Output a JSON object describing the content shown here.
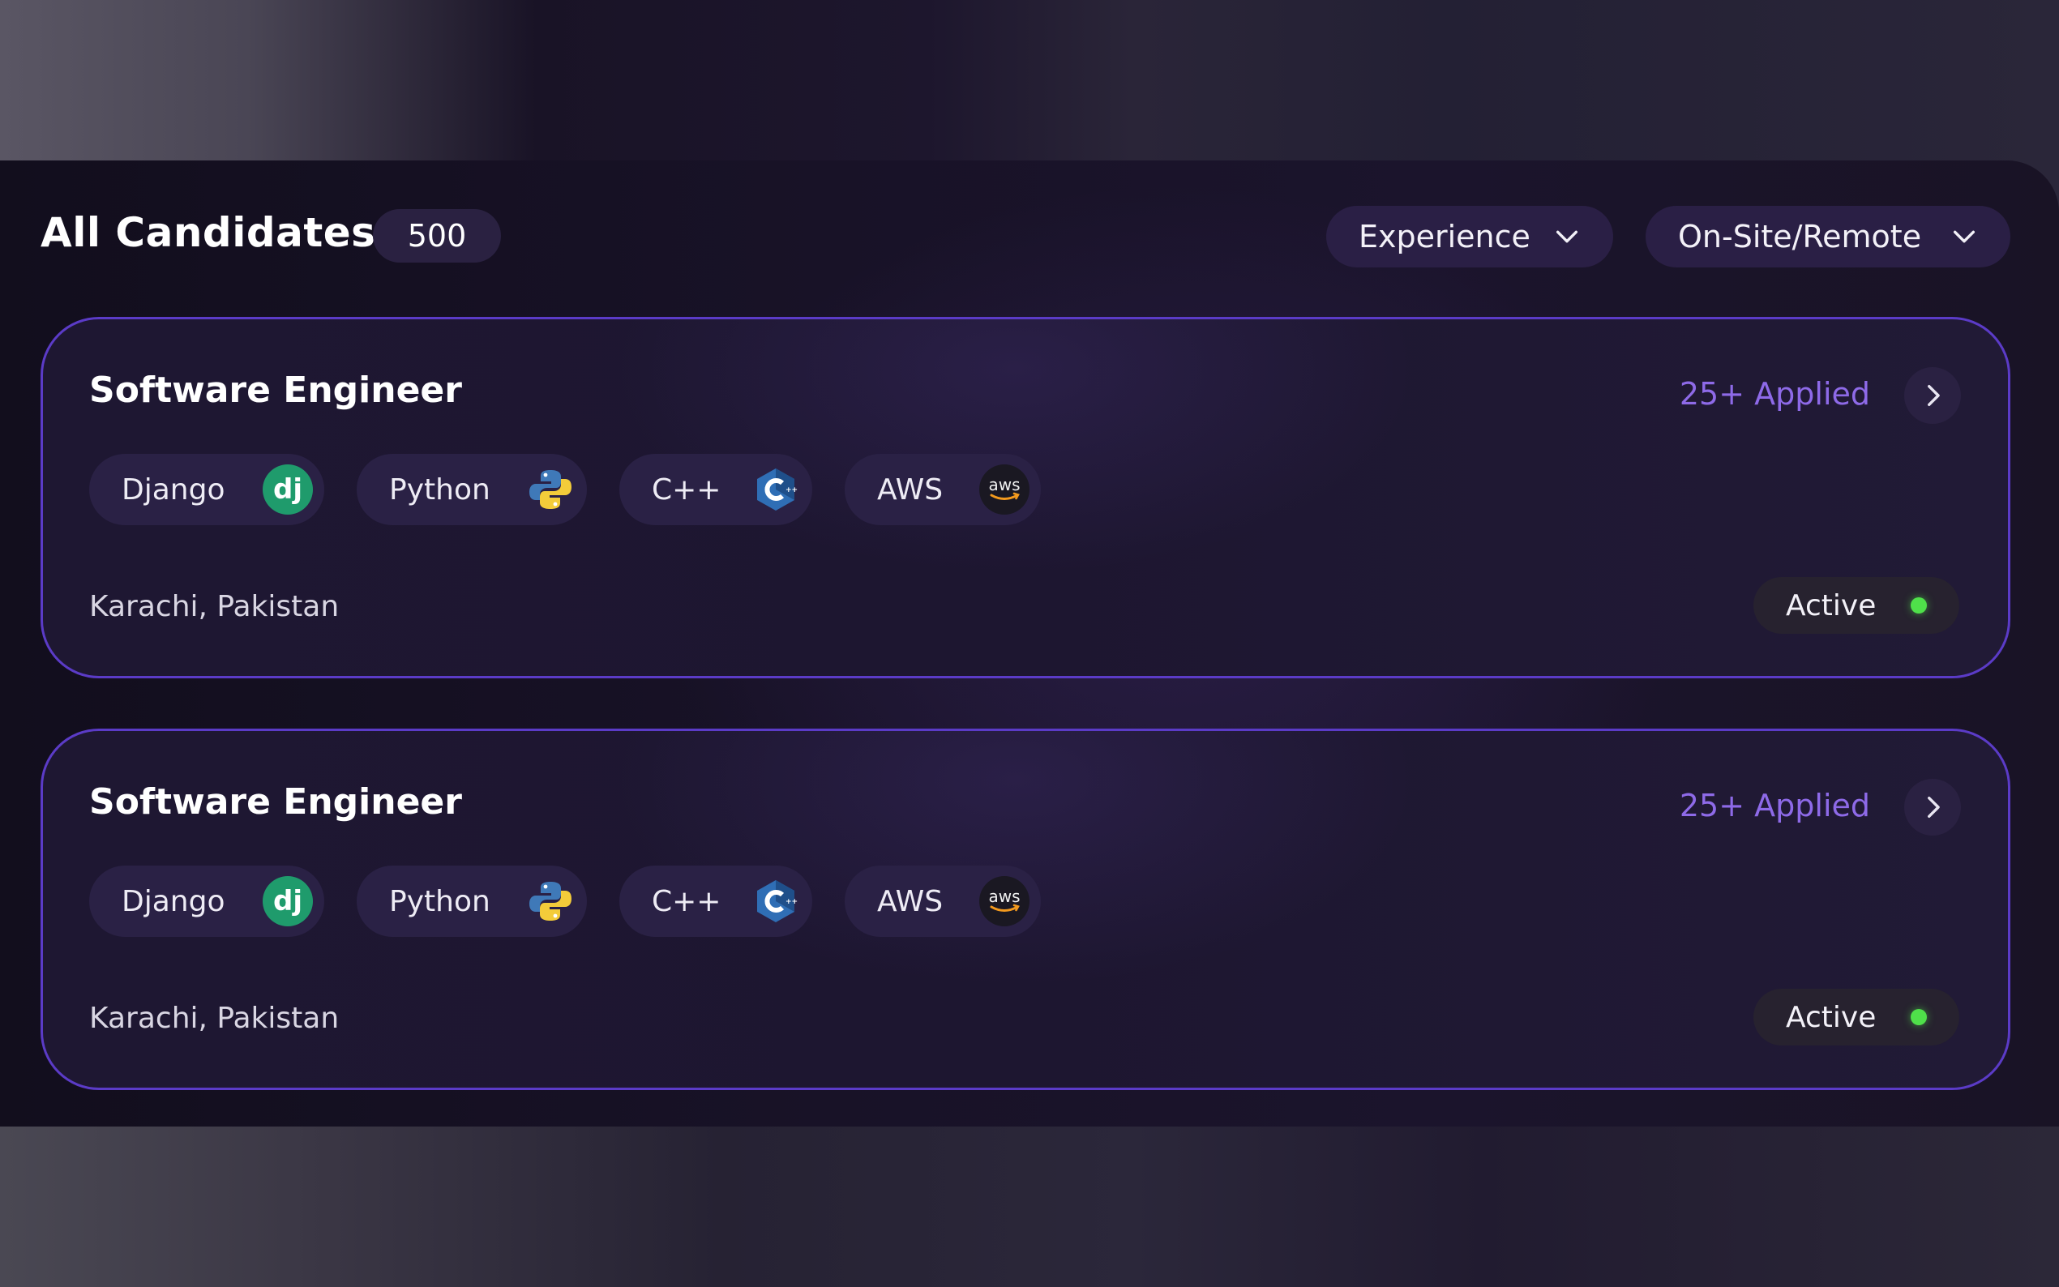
{
  "header": {
    "title": "All Candidates",
    "count": "500",
    "filters": [
      {
        "label": "Experience",
        "icon": "chevron-down-icon"
      },
      {
        "label": "On-Site/Remote",
        "icon": "chevron-down-icon"
      }
    ]
  },
  "colors": {
    "accent": "#5b3bc7",
    "applied_text": "#8e6ae8",
    "status_dot": "#4fe04a"
  },
  "cards": [
    {
      "title": "Software Engineer",
      "applied": "25+ Applied",
      "tags": [
        {
          "label": "Django",
          "icon": "django-icon",
          "logo_text": "dj"
        },
        {
          "label": "Python",
          "icon": "python-icon"
        },
        {
          "label": "C++",
          "icon": "cpp-icon"
        },
        {
          "label": "AWS",
          "icon": "aws-icon",
          "logo_text": "aws"
        }
      ],
      "location": "Karachi, Pakistan",
      "status": "Active"
    },
    {
      "title": "Software Engineer",
      "applied": "25+ Applied",
      "tags": [
        {
          "label": "Django",
          "icon": "django-icon",
          "logo_text": "dj"
        },
        {
          "label": "Python",
          "icon": "python-icon"
        },
        {
          "label": "C++",
          "icon": "cpp-icon"
        },
        {
          "label": "AWS",
          "icon": "aws-icon",
          "logo_text": "aws"
        }
      ],
      "location": "Karachi, Pakistan",
      "status": "Active"
    }
  ]
}
